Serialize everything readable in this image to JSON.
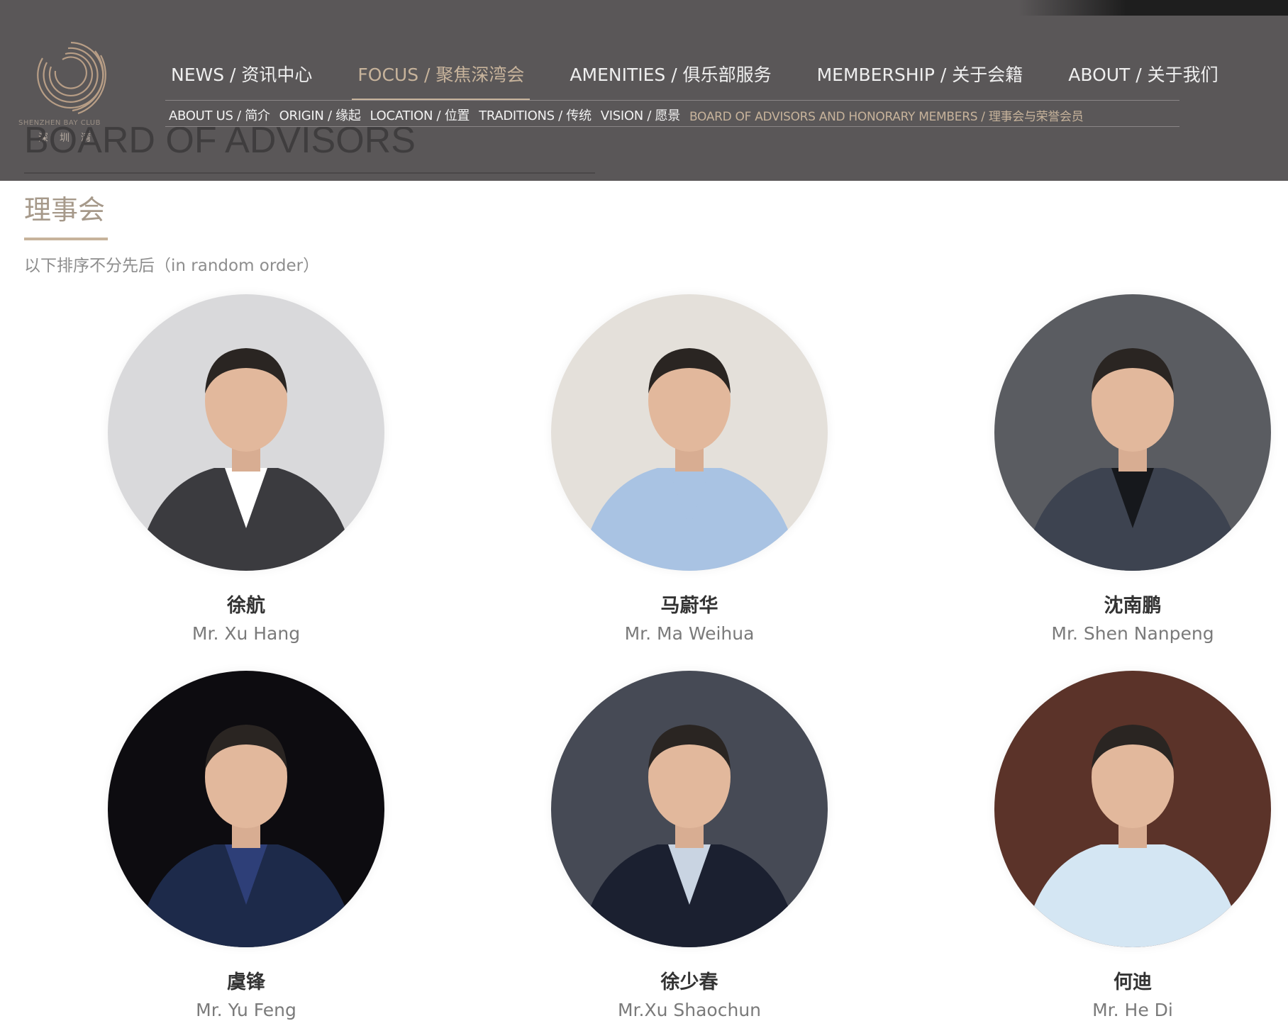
{
  "brand": {
    "name_en": "SHENZHEN BAY CLUB",
    "name_cn": "深圳湾"
  },
  "page_heading_ghost": "BOARD OF ADVISORS",
  "main_nav": [
    {
      "label": "NEWS / 资讯中心",
      "active": false
    },
    {
      "label": "FOCUS / 聚焦深湾会",
      "active": true
    },
    {
      "label": "AMENITIES / 俱乐部服务",
      "active": false
    },
    {
      "label": "MEMBERSHIP / 关于会籍",
      "active": false
    },
    {
      "label": "ABOUT / 关于我们",
      "active": false
    }
  ],
  "sub_nav": [
    {
      "label": "ABOUT US / 简介",
      "active": false
    },
    {
      "label": "ORIGIN / 缘起",
      "active": false
    },
    {
      "label": "LOCATION / 位置",
      "active": false
    },
    {
      "label": "TRADITIONS / 传统",
      "active": false
    },
    {
      "label": "VISION / 愿景",
      "active": false
    },
    {
      "label": "BOARD OF ADVISORS AND HONORARY MEMBERS / 理事会与荣誉会员",
      "active": true
    }
  ],
  "section": {
    "title": "理事会",
    "note": "以下排序不分先后（in random order）"
  },
  "members": [
    {
      "name_cn": "徐航",
      "name_en": "Mr. Xu Hang",
      "bg": "#d9d9db",
      "suit": "#3b3b3f",
      "shirt": "#ffffff"
    },
    {
      "name_cn": "马蔚华",
      "name_en": "Mr. Ma Weihua",
      "bg": "#e4e0da",
      "suit": "#a9c3e3",
      "shirt": "#a9c3e3"
    },
    {
      "name_cn": "沈南鹏",
      "name_en": "Mr. Shen Nanpeng",
      "bg": "#5a5c61",
      "suit": "#3d4350",
      "shirt": "#16181c"
    },
    {
      "name_cn": "虞锋",
      "name_en": "Mr. Yu Feng",
      "bg": "#0d0c10",
      "suit": "#1d2a4a",
      "shirt": "#2e3f78"
    },
    {
      "name_cn": "徐少春",
      "name_en": "Mr.Xu Shaochun",
      "bg": "#464a55",
      "suit": "#1b2030",
      "shirt": "#c9d4e2"
    },
    {
      "name_cn": "何迪",
      "name_en": "Mr. He Di",
      "bg": "#5b3329",
      "suit": "#d4e6f3",
      "shirt": "#d4e6f3"
    }
  ],
  "colors": {
    "header_bg": "#5a5758",
    "accent_gold": "#c7b39b",
    "title_tan": "#a6998a"
  }
}
